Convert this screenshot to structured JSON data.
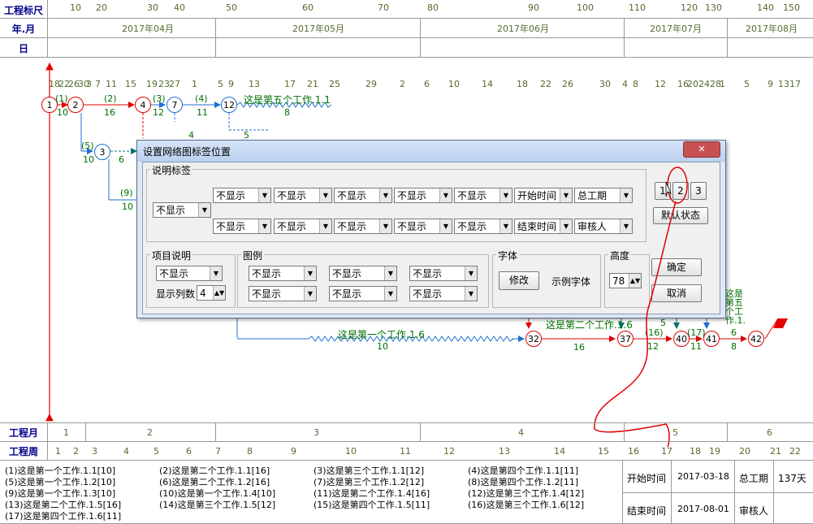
{
  "header": {
    "ruler_label": "工程标尺",
    "month_label": "年.月",
    "day_label": "日",
    "ruler_ticks": [
      "10",
      "20",
      "30",
      "40",
      "50",
      "60",
      "70",
      "80",
      "90",
      "100",
      "110",
      "120",
      "130",
      "140",
      "150"
    ],
    "months": [
      "2017年04月",
      "2017年05月",
      "2017年06月",
      "2017年07月",
      "2017年08月"
    ],
    "days": [
      "18",
      "22",
      "26",
      "30",
      "3",
      "7",
      "11",
      "15",
      "19",
      "23",
      "27",
      "1",
      "5",
      "9",
      "13",
      "17",
      "21",
      "25",
      "29",
      "2",
      "6",
      "10",
      "14",
      "18",
      "22",
      "26",
      "30",
      "4",
      "8",
      "12",
      "16",
      "20",
      "24",
      "28",
      "1",
      "5",
      "9",
      "13",
      "17"
    ]
  },
  "network": {
    "nodes": [
      "1",
      "2",
      "4",
      "7",
      "12",
      "3",
      "32",
      "37",
      "40",
      "41",
      "42"
    ],
    "tasks": [
      {
        "label": "(1)",
        "dur": "10"
      },
      {
        "label": "(2)",
        "dur": "16"
      },
      {
        "label": "(3)",
        "dur": "12"
      },
      {
        "label": "(4)",
        "dur": "11"
      },
      {
        "label": "这是第五个工作.1.1",
        "dur": "8"
      },
      {
        "label": "(5)",
        "dur": "10"
      },
      {
        "label": "(9)",
        "dur": "10"
      },
      {
        "label": "这是第一个工作.1.6",
        "dur": "10"
      },
      {
        "label": "这是第二个工作.1.6",
        "dur": "16"
      },
      {
        "label": "(16)",
        "dur": "12"
      },
      {
        "label": "(17)",
        "dur": "11"
      },
      {
        "label": "6",
        "dur": "8"
      }
    ],
    "misc": [
      "4",
      "5",
      "6",
      "5",
      "这是\n第五\n个工\n作.1."
    ]
  },
  "dialog": {
    "title": "设置网络图标签位置",
    "close": "✕",
    "section_labels": "说明标签",
    "left_select": "不显示",
    "row1": [
      "不显示",
      "不显示",
      "不显示",
      "不显示",
      "不显示",
      "开始时间",
      "总工期"
    ],
    "row2": [
      "不显示",
      "不显示",
      "不显示",
      "不显示",
      "不显示",
      "结束时间",
      "审核人"
    ],
    "pos_buttons": [
      "1",
      "2",
      "3"
    ],
    "default_btn": "默认状态",
    "project_desc": "项目说明",
    "project_select": "不显示",
    "cols_label": "显示列数",
    "cols_value": "4",
    "legend_label": "图例",
    "legend_selects": [
      "不显示",
      "不显示",
      "不显示",
      "不显示",
      "不显示",
      "不显示"
    ],
    "font_label": "字体",
    "font_modify": "修改",
    "font_sample": "示例字体",
    "height_label": "高度",
    "height_value": "78",
    "ok": "确定",
    "cancel": "取消"
  },
  "footer": {
    "month_row_label": "工程月",
    "week_row_label": "工程周",
    "months": [
      "1",
      "2",
      "3",
      "4",
      "5",
      "6"
    ],
    "weeks": [
      "1",
      "2",
      "3",
      "4",
      "5",
      "6",
      "7",
      "8",
      "9",
      "10",
      "11",
      "12",
      "13",
      "14",
      "15",
      "16",
      "17",
      "18",
      "19",
      "20",
      "21",
      "22"
    ]
  },
  "legend": [
    "(1)这是第一个工作.1.1[10]",
    "(2)这是第二个工作.1.1[16]",
    "(3)这是第三个工作.1.1[12]",
    "(4)这是第四个工作.1.1[11]",
    "(5)这是第一个工作.1.2[10]",
    "(6)这是第二个工作.1.2[16]",
    "(7)这是第三个工作.1.2[12]",
    "(8)这是第四个工作.1.2[11]",
    "(9)这是第一个工作.1.3[10]",
    "(10)这是第一个工作.1.4[10]",
    "(11)这是第二个工作.1.4[16]",
    "(12)这是第三个工作.1.4[12]",
    "(13)这是第二个工作.1.5[16]",
    "(14)这是第三个工作.1.5[12]",
    "(15)这是第四个工作.1.5[11]",
    "(16)这是第三个工作.1.6[12]",
    "(17)这是第四个工作.1.6[11]"
  ],
  "info": {
    "start_label": "开始时间",
    "start_value": "2017-03-18",
    "total_label": "总工期",
    "total_value": "137天",
    "end_label": "结束时间",
    "end_value": "2017-08-01",
    "reviewer_label": "审核人"
  },
  "colors": {
    "critical": "#e00000",
    "normal": "#1e6fd0",
    "label": "#007000",
    "header": "#00008b"
  }
}
